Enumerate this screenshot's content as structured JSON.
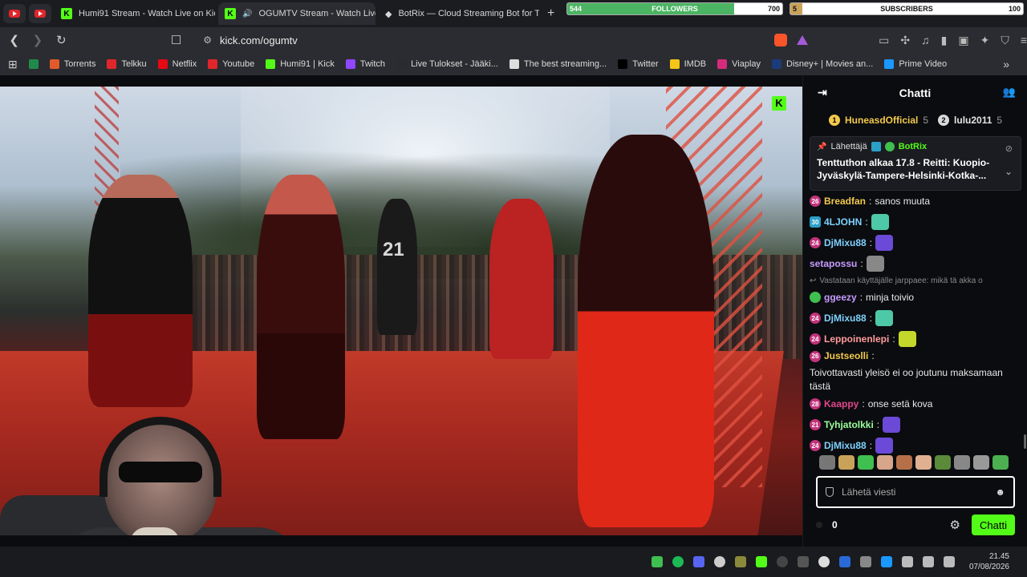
{
  "tabs": [
    {
      "title": "Humi91 Stream - Watch Live on Kick",
      "active": false
    },
    {
      "title": "OGUMTV Stream - Watch Live",
      "active": true
    },
    {
      "title": "BotRix — Cloud Streaming Bot for Tw",
      "active": false
    }
  ],
  "overlay": {
    "followers": {
      "current": "544",
      "label": "FOLLOWERS",
      "goal": "700",
      "progress": 0.777
    },
    "subscribers": {
      "current": "5",
      "label": "SUBSCRIBERS",
      "goal": "100",
      "progress": 0.05
    }
  },
  "address_bar": {
    "url": "kick.com/ogumtv"
  },
  "bookmarks": [
    {
      "label": "",
      "icon": "r-icon",
      "color": "#1f8a4c"
    },
    {
      "label": "Torrents",
      "icon": "x-icon",
      "color": "#e05a2a"
    },
    {
      "label": "Telkku",
      "icon": "t-icon",
      "color": "#e0262b"
    },
    {
      "label": "Netflix",
      "icon": "netflix-icon",
      "color": "#e50914"
    },
    {
      "label": "Youtube",
      "icon": "youtube-icon",
      "color": "#e0262b"
    },
    {
      "label": "Humi91 | Kick",
      "icon": "kick-icon",
      "color": "#53fc18"
    },
    {
      "label": "Twitch",
      "icon": "twitch-icon",
      "color": "#9146ff"
    },
    {
      "label": "Live Tulokset - Jääki...",
      "icon": "flashscore-icon",
      "color": "#2a2b30"
    },
    {
      "label": "The best streaming...",
      "icon": "botrix-icon",
      "color": "#ddd"
    },
    {
      "label": "Twitter",
      "icon": "x-icon",
      "color": "#000"
    },
    {
      "label": "IMDB",
      "icon": "imdb-icon",
      "color": "#f5c518"
    },
    {
      "label": "Viaplay",
      "icon": "viaplay-icon",
      "color": "#d62b7a"
    },
    {
      "label": "Disney+ | Movies an...",
      "icon": "disney-icon",
      "color": "#1a3c7a"
    },
    {
      "label": "Prime Video",
      "icon": "prime-icon",
      "color": "#1a98ff"
    }
  ],
  "video": {
    "jersey_number": "21"
  },
  "chat": {
    "title": "Chatti",
    "leaders": [
      {
        "rank": "1",
        "name": "HuneasdOfficial",
        "count": "5"
      },
      {
        "rank": "2",
        "name": "lulu2011",
        "count": "5"
      }
    ],
    "pinned": {
      "by_label": "Lähettäjä",
      "author": "BotRix",
      "text": "Tenttuthon alkaa 17.8 - Reitti: Kuopio-Jyväskylä-Tampere-Helsinki-Kotka-..."
    },
    "messages": [
      {
        "badge": "26",
        "badge_style": "pink",
        "user": "Breadfan",
        "color": "#f2c94c",
        "text": "sanos muuta",
        "emote": ""
      },
      {
        "badge": "30",
        "badge_style": "blue",
        "user": "4LJOHN",
        "color": "#7fd1ff",
        "text": "",
        "emote": "#4ec9a8"
      },
      {
        "badge": "24",
        "badge_style": "pink",
        "user": "DjMixu88",
        "color": "#7fd1ff",
        "text": "",
        "emote": "#6a4ad6"
      },
      {
        "badge": "",
        "badge_style": "",
        "user": "setapossu",
        "color": "#c79bff",
        "text": "",
        "emote": "#888"
      },
      {
        "badge": "",
        "badge_style": "reply",
        "user": "",
        "color": "",
        "text": "Vastataan käyttäjälle jarppaee: mikä tä akka o",
        "emote": ""
      },
      {
        "badge": "",
        "badge_style": "green",
        "user": "ggeezy",
        "color": "#c79bff",
        "text": "minja toivio",
        "emote": ""
      },
      {
        "badge": "24",
        "badge_style": "pink",
        "user": "DjMixu88",
        "color": "#7fd1ff",
        "text": "",
        "emote": "#4ec9a8"
      },
      {
        "badge": "24",
        "badge_style": "pink",
        "user": "Leppoinenlepi",
        "color": "#ff9b9b",
        "text": "",
        "emote": "#c4d82b"
      },
      {
        "badge": "26",
        "badge_style": "pink",
        "user": "Justseolli",
        "color": "#f2c94c",
        "text": "Toivottavasti yleisö ei oo joutunu maksamaan tästä",
        "emote": ""
      },
      {
        "badge": "28",
        "badge_style": "pink",
        "user": "Kaappy",
        "color": "#e0468a",
        "text": "onse setä kova",
        "emote": ""
      },
      {
        "badge": "21",
        "badge_style": "pink",
        "user": "Tyhjatolkki",
        "color": "#9bff9b",
        "text": "",
        "emote": "#6a4ad6"
      },
      {
        "badge": "24",
        "badge_style": "pink",
        "user": "DjMixu88",
        "color": "#7fd1ff",
        "text": "",
        "emote": "#6a4ad6"
      }
    ],
    "input_placeholder": "Lähetä viesti",
    "points": "0",
    "send_label": "Chatti"
  },
  "taskbar": {
    "time": "21.45",
    "date": "07/08/2026"
  }
}
